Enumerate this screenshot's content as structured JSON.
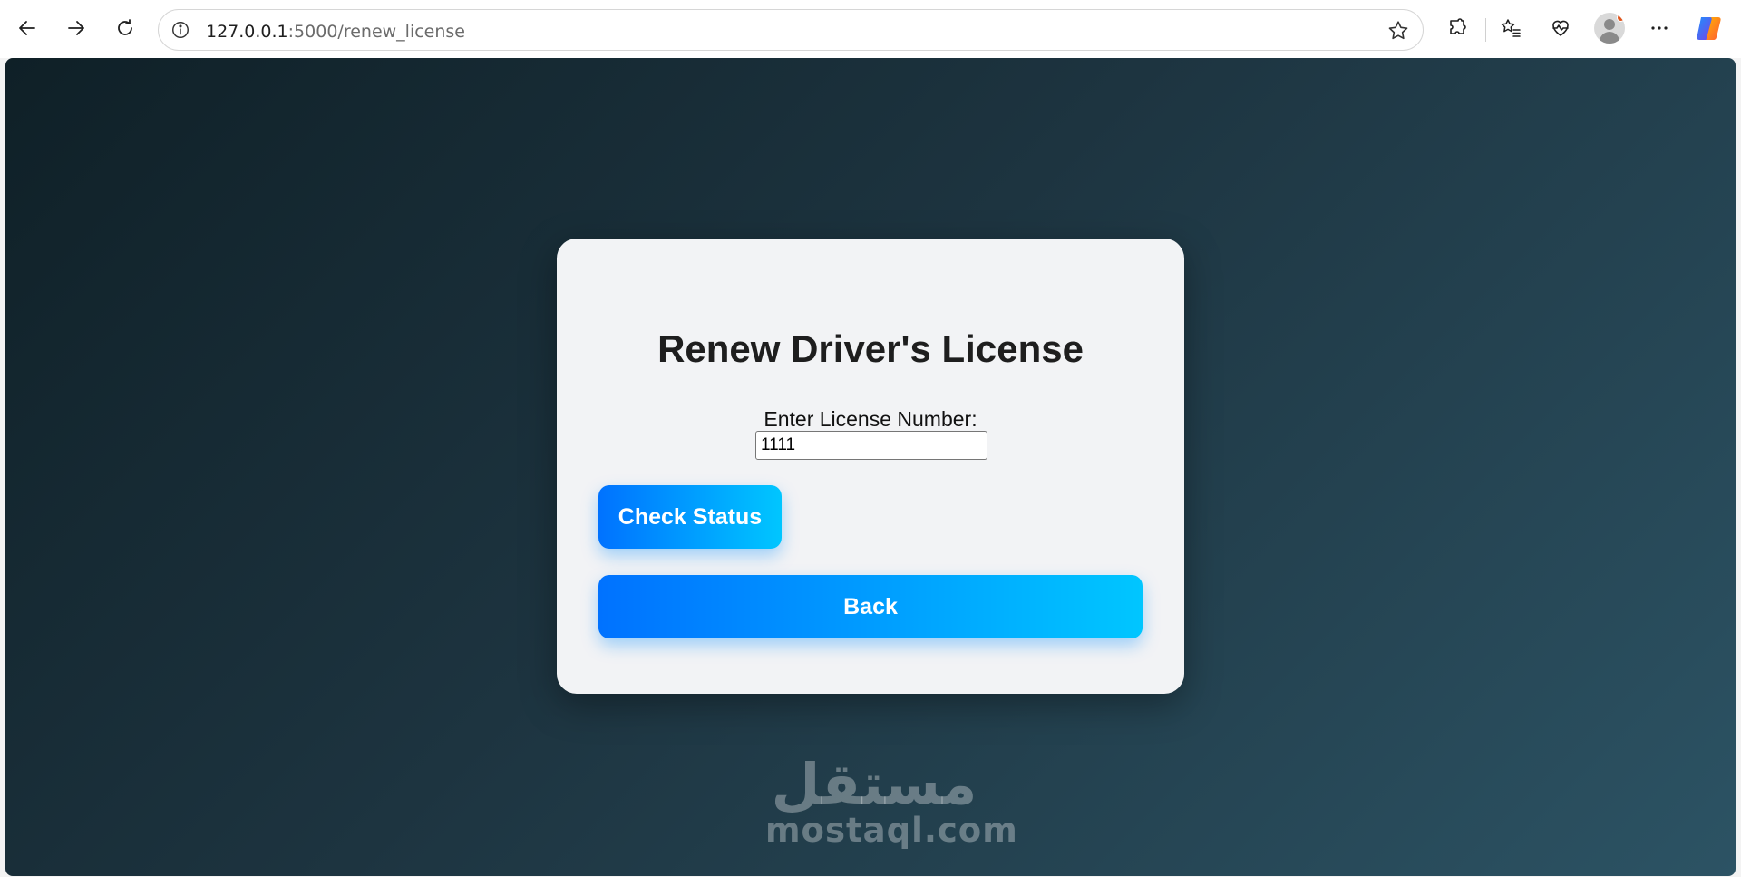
{
  "browser": {
    "url_host": "127.0.0.1",
    "url_rest": ":5000/renew_license"
  },
  "form": {
    "title": "Renew Driver's License",
    "license_label": "Enter License Number:",
    "license_value": "1111",
    "check_button": "Check Status",
    "back_button": "Back"
  },
  "watermark": {
    "arabic": "مستقل",
    "latin": "mostaql.com"
  },
  "colors": {
    "button_gradient_start": "#0072ff",
    "button_gradient_end": "#00c6ff",
    "background_dark": "#0f2027",
    "background_light": "#2c5364"
  }
}
